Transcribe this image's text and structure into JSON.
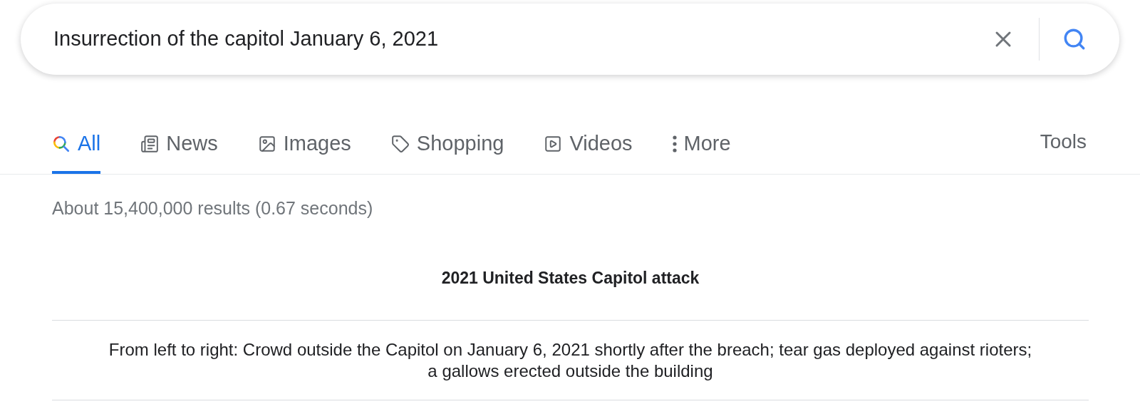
{
  "search": {
    "query": "Insurrection of the capitol January 6, 2021"
  },
  "tabs": [
    {
      "label": "All",
      "kind": "all",
      "selected": true
    },
    {
      "label": "News",
      "kind": "news",
      "selected": false
    },
    {
      "label": "Images",
      "kind": "images",
      "selected": false
    },
    {
      "label": "Shopping",
      "kind": "shopping",
      "selected": false
    },
    {
      "label": "Videos",
      "kind": "videos",
      "selected": false
    },
    {
      "label": "More",
      "kind": "more",
      "selected": false
    }
  ],
  "tools": "Tools",
  "result_stats": "About 15,400,000 results (0.67 seconds)",
  "panel": {
    "title": "2021 United States Capitol attack",
    "caption": "From left to right: Crowd outside the Capitol on January 6, 2021 shortly after the breach; tear gas deployed against rioters; a gallows erected outside the building"
  }
}
